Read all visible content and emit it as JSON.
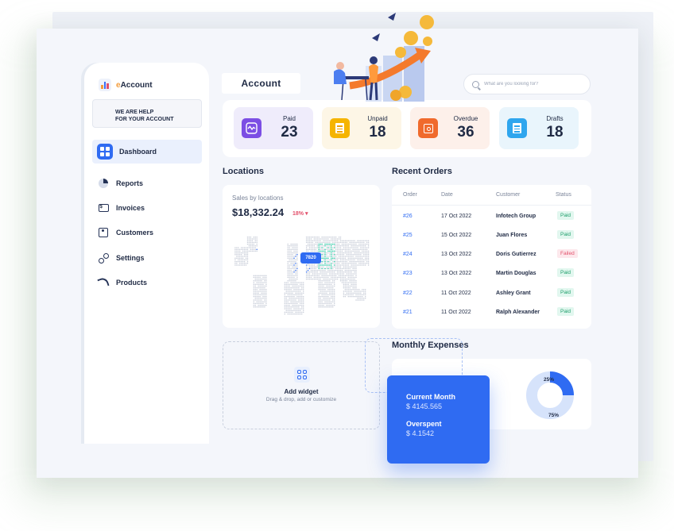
{
  "app": {
    "logo_text": "Account",
    "page_title": "Account"
  },
  "sidebar": {
    "help_text": "WE ARE HELP\nFOR YOUR ACCOUNT",
    "items": [
      {
        "label": "Dashboard",
        "icon": "dashboard-icon",
        "active": true
      },
      {
        "label": "Reports",
        "icon": "reports-icon"
      },
      {
        "label": "Invoices",
        "icon": "invoices-icon"
      },
      {
        "label": "Customers",
        "icon": "customers-icon"
      },
      {
        "label": "Settings",
        "icon": "settings-icon"
      },
      {
        "label": "Products",
        "icon": "products-icon"
      }
    ]
  },
  "search": {
    "placeholder": "What are you looking for?"
  },
  "stats": [
    {
      "label": "Paid",
      "value": "23",
      "icon": "activity-icon",
      "bg": "#efecfb",
      "icon_color": "#7c4ee4"
    },
    {
      "label": "Unpaid",
      "value": "18",
      "icon": "document-icon",
      "bg": "#fdf6e6",
      "icon_color": "#f5b400"
    },
    {
      "label": "Overdue",
      "value": "36",
      "icon": "safe-icon",
      "bg": "#fdf0ea",
      "icon_color": "#f06a2c"
    },
    {
      "label": "Drafts",
      "value": "18",
      "icon": "document-icon",
      "bg": "#e9f5fc",
      "icon_color": "#2fa6ee"
    }
  ],
  "locations": {
    "title": "Locations",
    "subtitle": "Sales by locations",
    "total": "$18,332.24",
    "change": "18%",
    "pin_value": "7820"
  },
  "orders": {
    "title": "Recent Orders",
    "columns": [
      "Order",
      "Date",
      "Customer",
      "Status"
    ],
    "rows": [
      {
        "id": "#26",
        "date": "17 Oct 2022",
        "customer": "Infotech Group",
        "status": "Paid"
      },
      {
        "id": "#25",
        "date": "15 Oct 2022",
        "customer": "Juan Flores",
        "status": "Paid"
      },
      {
        "id": "#24",
        "date": "13 Oct 2022",
        "customer": "Doris Gutierrez",
        "status": "Failed"
      },
      {
        "id": "#23",
        "date": "13 Oct 2022",
        "customer": "Martin Douglas",
        "status": "Paid"
      },
      {
        "id": "#22",
        "date": "11 Oct 2022",
        "customer": "Ashley Grant",
        "status": "Paid"
      },
      {
        "id": "#21",
        "date": "11 Oct 2022",
        "customer": "Ralph Alexander",
        "status": "Paid"
      }
    ]
  },
  "widget": {
    "title": "Add widget",
    "subtitle": "Drag & drop, add or customize"
  },
  "expenses": {
    "title": "Monthly Expenses",
    "current_label": "Current Month",
    "current_value": "$ 4145.565",
    "overspent_label": "Overspent",
    "overspent_value": "$ 4.1542",
    "donut": {
      "segments": [
        25,
        75
      ],
      "labels": [
        "25%",
        "75%"
      ]
    }
  },
  "colors": {
    "accent": "#2f6bf2",
    "paid": "#1e9e6a",
    "failed": "#e2506b"
  }
}
